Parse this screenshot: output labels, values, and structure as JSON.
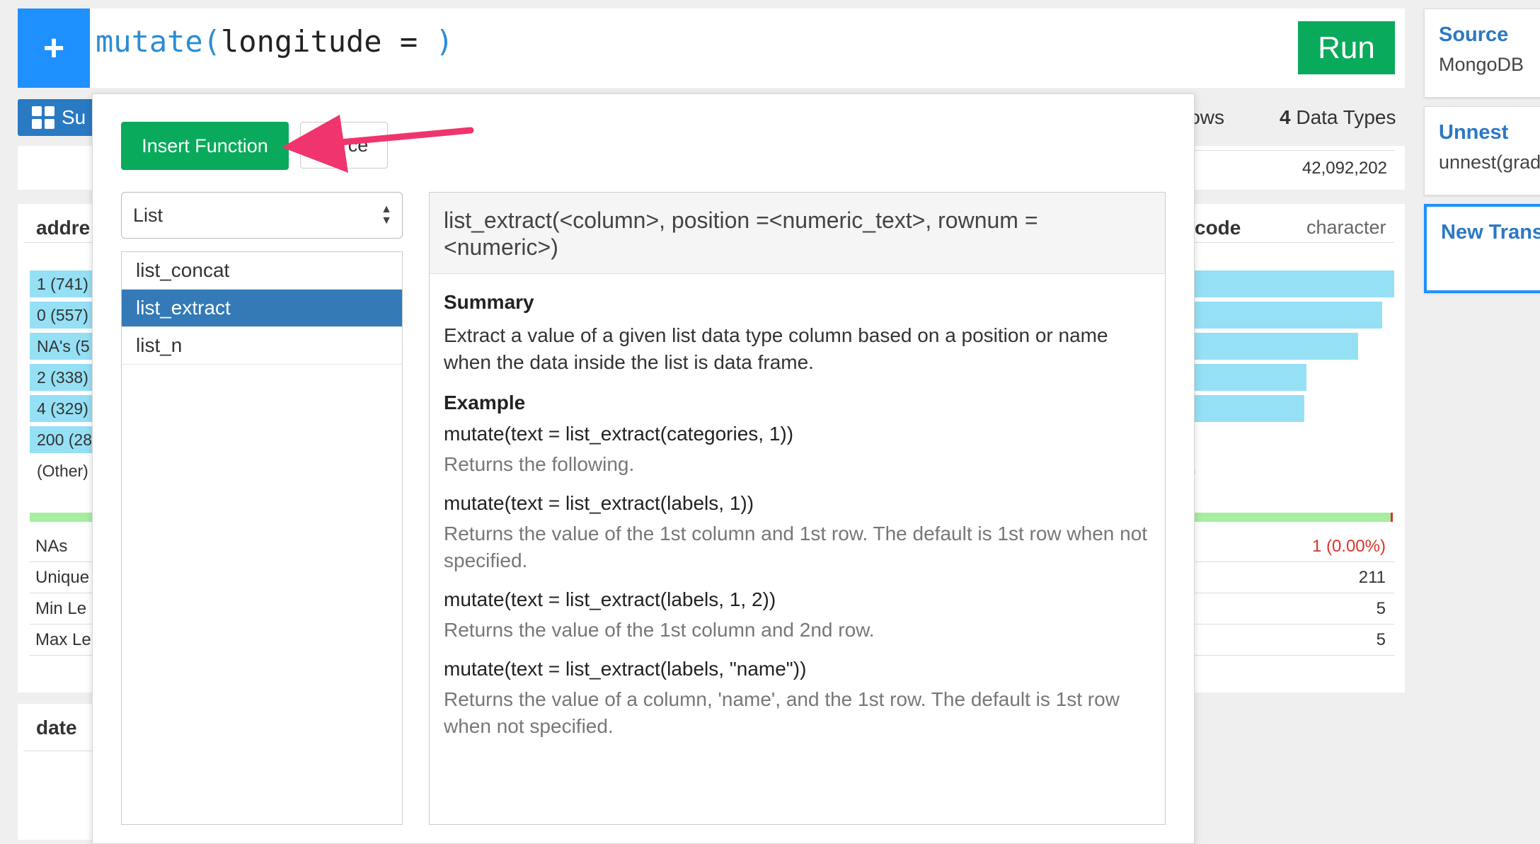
{
  "command": {
    "fn": "mutate(",
    "arg": "longitude = ",
    "close": ")"
  },
  "toolbar": {
    "plus_label": "+",
    "run_label": "Run",
    "summary_label": "Su"
  },
  "background": {
    "rows_label": "Rows",
    "data_types_count": "4",
    "data_types_label": "Data Types",
    "total_rows": "42,092,202",
    "left_column": {
      "name": "addre",
      "bars": [
        "1 (741)",
        "0 (557)",
        "NA's (5",
        "2 (338)",
        "4 (329)",
        "200 (28"
      ],
      "bar_fractions": [
        0.55,
        0.5,
        0.45,
        0.4,
        0.38,
        0.35
      ],
      "other_label": "(Other)",
      "stats": [
        "NAs",
        "Unique",
        "Min Le",
        "Max Le"
      ]
    },
    "right_column": {
      "name": "code",
      "type": "character",
      "bar_fractions": [
        1.0,
        0.94,
        0.82,
        0.56,
        0.55
      ],
      "other_value": ")",
      "stats": [
        "1 (0.00%)",
        "211",
        "5",
        "5"
      ],
      "na_color": "#d9342b"
    },
    "date_column": {
      "name": "date"
    }
  },
  "popup": {
    "insert_label": "Insert Function",
    "cancel_label": "ce",
    "category": "List",
    "functions": [
      {
        "label": "list_concat",
        "selected": false
      },
      {
        "label": "list_extract",
        "selected": true
      },
      {
        "label": "list_n",
        "selected": false
      }
    ],
    "detail": {
      "signature": "list_extract(<column>, position =<numeric_text>, rownum = <numeric>)",
      "summary_heading": "Summary",
      "summary_text": "Extract a value of a given list data type column based on a position or name when the data inside the list is data frame.",
      "example_heading": "Example",
      "examples": [
        {
          "code": "mutate(text = list_extract(categories, 1))",
          "desc": "Returns the following."
        },
        {
          "code": "mutate(text = list_extract(labels, 1))",
          "desc": "Returns the value of the 1st column and 1st row. The default is 1st row when not specified."
        },
        {
          "code": "mutate(text = list_extract(labels, 1, 2))",
          "desc": "Returns the value of the 1st column and 2nd row."
        },
        {
          "code": "mutate(text = list_extract(labels, \"name\"))",
          "desc": "Returns the value of a column, 'name', and the 1st row. The default is 1st row when not specified."
        }
      ]
    }
  },
  "steps": [
    {
      "title": "Source",
      "subtitle": "MongoDB"
    },
    {
      "title": "Unnest",
      "subtitle": "unnest(grad"
    },
    {
      "title": "New Trans",
      "subtitle": ""
    }
  ],
  "colors": {
    "accent_blue": "#1e90ff",
    "run_green": "#0aaa5c",
    "selected_blue": "#337ab7",
    "bar_cyan": "#95e0f5",
    "arrow_pink": "#f0346e"
  }
}
